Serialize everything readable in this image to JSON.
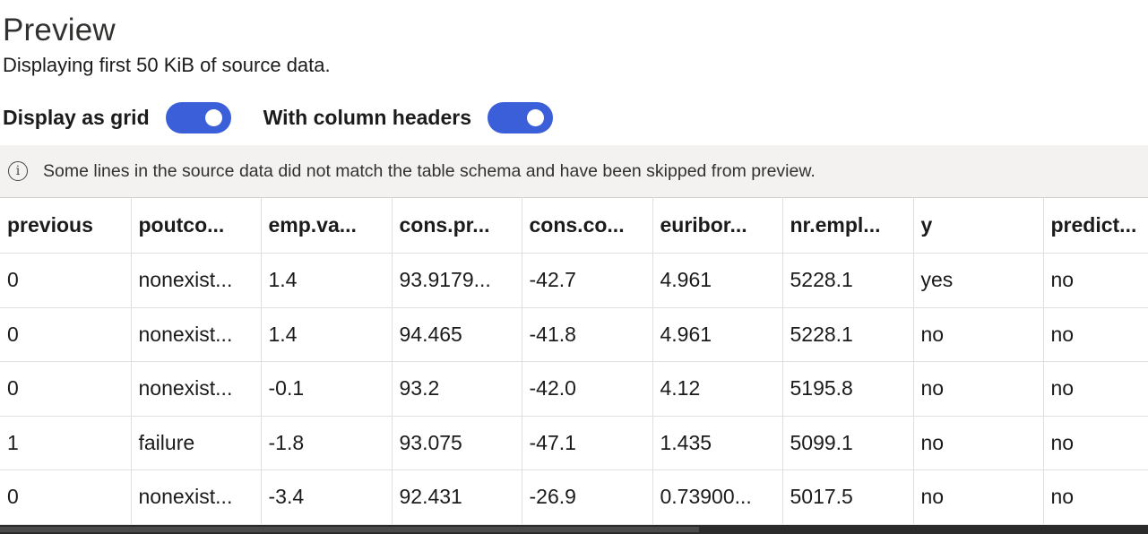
{
  "header": {
    "title": "Preview",
    "subtitle": "Displaying first 50 KiB of source data."
  },
  "toggles": {
    "display_as_grid": {
      "label": "Display as grid",
      "on": true
    },
    "column_headers": {
      "label": "With column headers",
      "on": true
    }
  },
  "info": {
    "icon": "info-icon",
    "message": "Some lines in the source data did not match the table schema and have been skipped from preview."
  },
  "table": {
    "columns": [
      "previous",
      "poutco...",
      "emp.va...",
      "cons.pr...",
      "cons.co...",
      "euribor...",
      "nr.empl...",
      "y",
      "predict..."
    ],
    "rows": [
      [
        "0",
        "nonexist...",
        "1.4",
        "93.9179...",
        "-42.7",
        "4.961",
        "5228.1",
        "yes",
        "no"
      ],
      [
        "0",
        "nonexist...",
        "1.4",
        "94.465",
        "-41.8",
        "4.961",
        "5228.1",
        "no",
        "no"
      ],
      [
        "0",
        "nonexist...",
        "-0.1",
        "93.2",
        "-42.0",
        "4.12",
        "5195.8",
        "no",
        "no"
      ],
      [
        "1",
        "failure",
        "-1.8",
        "93.075",
        "-47.1",
        "1.435",
        "5099.1",
        "no",
        "no"
      ],
      [
        "0",
        "nonexist...",
        "-3.4",
        "92.431",
        "-26.9",
        "0.73900...",
        "5017.5",
        "no",
        "no"
      ]
    ]
  },
  "colors": {
    "toggle_on": "#3a5fd8",
    "info_bar_bg": "#f3f2f1",
    "grid_border": "#e1dfdd"
  }
}
